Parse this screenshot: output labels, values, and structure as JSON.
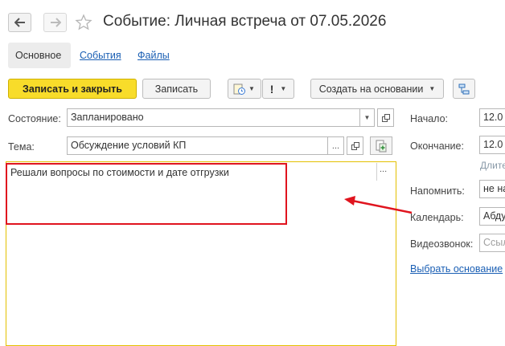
{
  "window": {
    "title": "Событие: Личная встреча от 07.05.2026",
    "nav_back_icon": "arrow-left-icon",
    "nav_forward_icon": "arrow-right-icon",
    "favorite_icon": "star-icon"
  },
  "tabs": [
    {
      "label": "Основное",
      "active": true
    },
    {
      "label": "События",
      "active": false
    },
    {
      "label": "Файлы",
      "active": false
    }
  ],
  "toolbar": {
    "save_close_label": "Записать и закрыть",
    "save_label": "Записать",
    "important_label": "!",
    "create_based_label": "Создать на основании",
    "accent_color": "#f8dc2a"
  },
  "form": {
    "state_label": "Состояние:",
    "state_value": "Запланировано",
    "subject_label": "Тема:",
    "subject_value": "Обсуждение условий КП",
    "description": "Решали вопросы по стоимости и дате отгрузки",
    "more_label": "...",
    "start_label": "Начало:",
    "start_value": "12.0",
    "end_label": "Окончание:",
    "end_value": "12.0",
    "duration_hint": "Длите",
    "remind_label": "Напомнить:",
    "remind_value": "не на",
    "calendar_label": "Календарь:",
    "calendar_value": "Абду",
    "video_label": "Видеозвонок:",
    "video_placeholder": "Ссыл",
    "choose_basis_link": "Выбрать основание"
  },
  "annotation": {
    "highlight_color": "#e0141e"
  }
}
